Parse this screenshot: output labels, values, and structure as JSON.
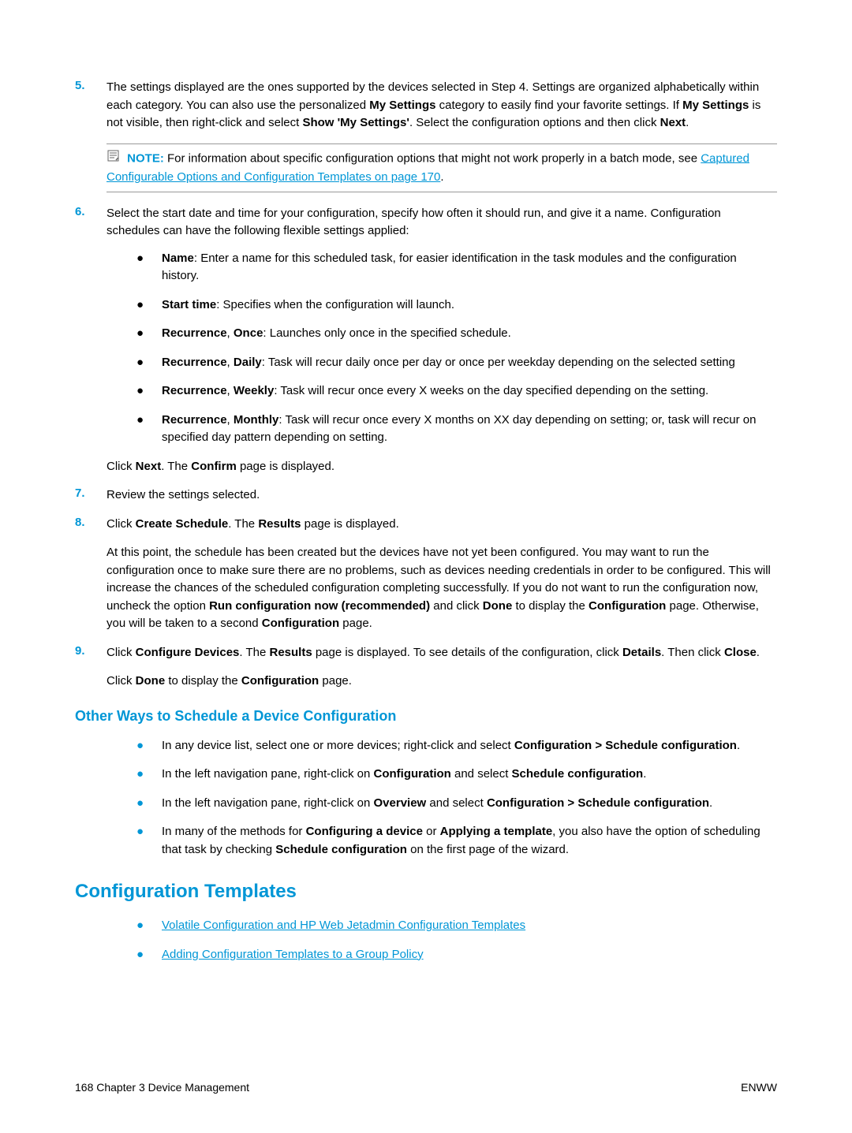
{
  "steps": {
    "s5": {
      "num": "5.",
      "text": "The settings displayed are the ones supported by the devices selected in Step 4. Settings are organized alphabetically within each category. You can also use the personalized <b>My Settings</b> category to easily find your favorite settings. If <b>My Settings</b> is not visible, then right-click and select <b>Show 'My Settings'</b>. Select the configuration options and then click <b>Next</b>."
    },
    "note": {
      "label": "NOTE:",
      "text": "For information about specific configuration options that might not work properly in a batch mode, see ",
      "link": "Captured Configurable Options and Configuration Templates on page 170",
      "after": "."
    },
    "s6": {
      "num": "6.",
      "text": "Select the start date and time for your configuration, specify how often it should run, and give it a name. Configuration schedules can have the following flexible settings applied:"
    },
    "s6_bullets": [
      "<b>Name</b>: Enter a name for this scheduled task, for easier identification in the task modules and the configuration history.",
      "<b>Start time</b>: Specifies when the configuration will launch.",
      "<b>Recurrence</b>, <b>Once</b>: Launches only once in the specified schedule.",
      "<b>Recurrence</b>, <b>Daily</b>: Task will recur daily once per day or once per weekday depending on the selected setting",
      "<b>Recurrence</b>, <b>Weekly</b>: Task will recur once every X weeks on the day specified depending on the setting.",
      "<b>Recurrence</b>, <b>Monthly</b>: Task will recur once every X months on XX day depending on setting; or, task will recur on specified day pattern depending on setting."
    ],
    "s6_after": "Click <b>Next</b>. The <b>Confirm</b> page is displayed.",
    "s7": {
      "num": "7.",
      "text": "Review the settings selected."
    },
    "s8": {
      "num": "8.",
      "text": "Click <b>Create Schedule</b>. The <b>Results</b> page is displayed.",
      "para": "At this point, the schedule has been created but the devices have not yet been configured. You may want to run the configuration once to make sure there are no problems, such as devices needing credentials in order to be configured. This will increase the chances of the scheduled configuration completing successfully. If you do not want to run the configuration now, uncheck the option <b>Run configuration now (recommended)</b> and click <b>Done</b> to display the <b>Configuration</b> page. Otherwise, you will be taken to a second <b>Configuration</b> page."
    },
    "s9": {
      "num": "9.",
      "text": "Click <b>Configure Devices</b>. The <b>Results</b> page is displayed. To see details of the configuration, click <b>Details</b>. Then click <b>Close</b>.",
      "after": "Click <b>Done</b> to display the <b>Configuration</b> page."
    }
  },
  "h3": "Other Ways to Schedule a Device Configuration",
  "other_bullets": [
    "In any device list, select one or more devices; right-click and select <b>Configuration > Schedule configuration</b>.",
    "In the left navigation pane, right-click on <b>Configuration</b> and select <b>Schedule configuration</b>.",
    "In the left navigation pane, right-click on <b>Overview</b> and select <b>Configuration > Schedule configuration</b>.",
    "In many of the methods for <b>Configuring a device</b> or <b>Applying a template</b>, you also have the option of scheduling that task by checking <b>Schedule configuration</b> on the first page of the wizard."
  ],
  "h2": "Configuration Templates",
  "ct_links": [
    "Volatile Configuration and HP Web Jetadmin Configuration Templates",
    "Adding Configuration Templates to a Group Policy"
  ],
  "footer": {
    "left": "168   Chapter 3   Device Management",
    "right": "ENWW"
  }
}
